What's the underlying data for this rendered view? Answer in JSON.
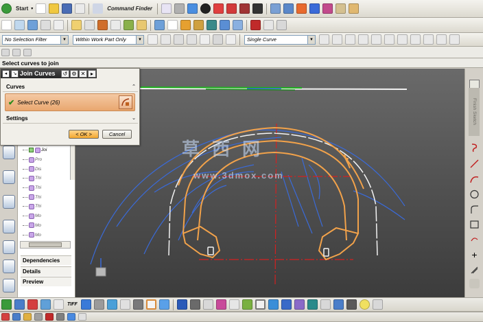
{
  "toolbar": {
    "start_label": "Start",
    "command_finder_label": "Command Finder"
  },
  "filters": {
    "selection_filter": "No Selection Filter",
    "scope": "Within Work Part Only",
    "curve_rule": "Single Curve"
  },
  "status": {
    "prompt": "Select curves to join"
  },
  "dialog": {
    "title": "Join Curves",
    "curves_group": "Curves",
    "select_curve_label": "Select Curve (26)",
    "settings_group": "Settings",
    "ok_label": "< OK >",
    "cancel_label": "Cancel"
  },
  "navigator": {
    "rows": [
      "Joi",
      "Pro",
      "Dis",
      "Thi",
      "Thi",
      "Thi",
      "Thi",
      "Mo",
      "Mo",
      "Mo"
    ],
    "sections": [
      "Dependencies",
      "Details",
      "Preview"
    ]
  },
  "right_bar": {
    "finish_sketch_label": "Finish Sketch"
  },
  "bottom_bar": {
    "tiff_label": "TIFF"
  },
  "watermark": {
    "chars": "草西网",
    "url": "www.3dmox.com"
  },
  "colors": {
    "viewport_top": "#6a6a6a",
    "viewport_bottom": "#3c3c3c",
    "selected_curve": "#f2a24a",
    "reference_curve": "#3a6ad8",
    "axis": "#d42020",
    "dialog_title": "#2b2b2b",
    "select_highlight": "#eda875",
    "ok_button": "#f5b84a"
  }
}
